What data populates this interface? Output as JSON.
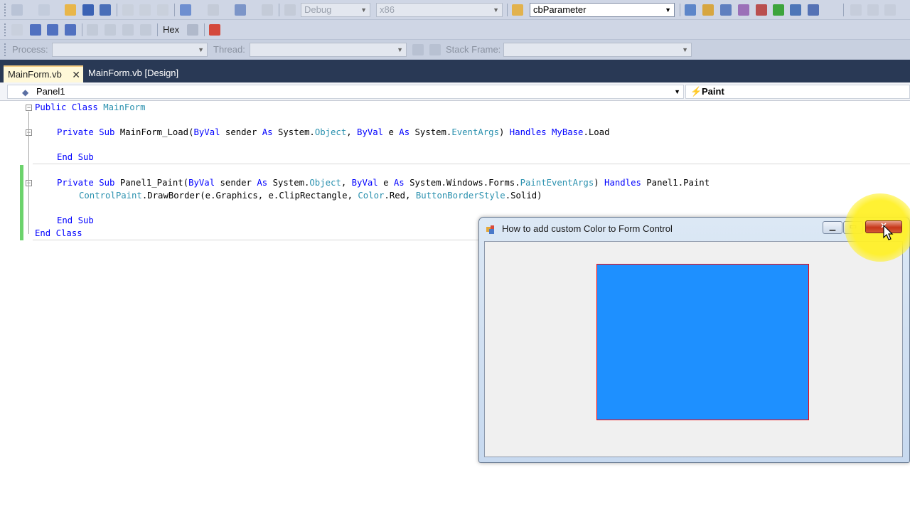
{
  "toolbar1": {
    "config": "Debug",
    "platform": "x86",
    "find_box": "cbParameter"
  },
  "toolbar2": {
    "hex_label": "Hex"
  },
  "toolbar3": {
    "process_label": "Process:",
    "thread_label": "Thread:",
    "stackframe_label": "Stack Frame:"
  },
  "tabs": [
    {
      "label": "MainForm.vb",
      "active": true
    },
    {
      "label": "MainForm.vb [Design]",
      "active": false
    }
  ],
  "navbar": {
    "object": "Panel1",
    "event": "Paint"
  },
  "code": {
    "l1": [
      "Public Class ",
      "MainForm"
    ],
    "l3": [
      "Private Sub ",
      "MainForm_Load(",
      "ByVal",
      " sender ",
      "As",
      " System.",
      "Object",
      ", ",
      "ByVal",
      " e ",
      "As",
      " System.",
      "EventArgs",
      ") ",
      "Handles",
      " ",
      "MyBase",
      ".Load"
    ],
    "l5": [
      "End Sub"
    ],
    "l7": [
      "Private Sub ",
      "Panel1_Paint(",
      "ByVal",
      " sender ",
      "As",
      " System.",
      "Object",
      ", ",
      "ByVal",
      " e ",
      "As",
      " System.Windows.Forms.",
      "PaintEventArgs",
      ") ",
      "Handles",
      " Panel1.Paint"
    ],
    "l8": [
      "ControlPaint",
      ".DrawBorder(e.Graphics, e.ClipRectangle, ",
      "Color",
      ".Red, ",
      "ButtonBorderStyle",
      ".Solid)"
    ],
    "l10": [
      "End Sub"
    ],
    "l11": [
      "End Class"
    ]
  },
  "form_window": {
    "title": "How to add custom Color to Form Control",
    "panel_fill": "#1e90ff",
    "panel_border": "#ff0000"
  }
}
